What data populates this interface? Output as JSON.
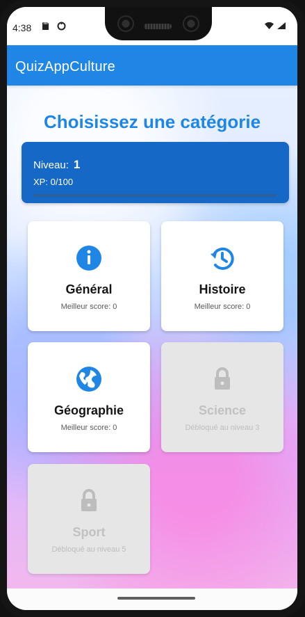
{
  "status_bar": {
    "time": "4:38",
    "left_icons": [
      "sd-card-icon",
      "circle-icon"
    ],
    "right_icons": [
      "wifi-icon",
      "signal-icon"
    ]
  },
  "app_bar": {
    "title": "QuizAppCulture",
    "color": "#1F86E5"
  },
  "page": {
    "heading": "Choisissez une catégorie"
  },
  "progress": {
    "level_label": "Niveau:",
    "level_value": "1",
    "xp_label": "XP:",
    "xp_value": "0/100",
    "xp_fraction": 0
  },
  "categories": [
    {
      "title": "Général",
      "subtitle": "Meilleur score: 0",
      "icon": "info-icon",
      "locked": false
    },
    {
      "title": "Histoire",
      "subtitle": "Meilleur score: 0",
      "icon": "history-icon",
      "locked": false
    },
    {
      "title": "Géographie",
      "subtitle": "Meilleur score: 0",
      "icon": "globe-icon",
      "locked": false
    },
    {
      "title": "Science",
      "subtitle": "Débloqué au niveau 3",
      "icon": "lock-icon",
      "locked": true
    },
    {
      "title": "Sport",
      "subtitle": "Débloqué au niveau 5",
      "icon": "lock-icon",
      "locked": true
    }
  ],
  "colors": {
    "accent": "#1F86E5",
    "card_blue": "#1668C6",
    "locked_gray": "#E6E6E6"
  }
}
